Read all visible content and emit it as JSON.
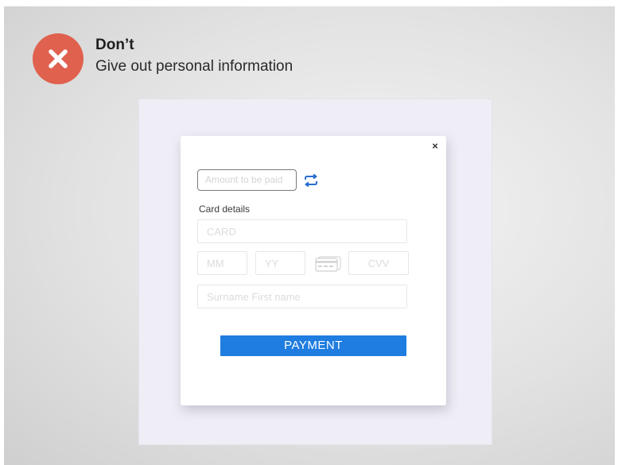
{
  "header": {
    "badge_icon": "x-icon",
    "badge_color": "#e0614e",
    "title": "Don’t",
    "subtitle": "Give out personal information"
  },
  "form": {
    "close_icon": "close-icon",
    "close_glyph": "×",
    "amount_placeholder": "Amount to be paid",
    "swap_icon": "swap-arrows-icon",
    "section_label": "Card details",
    "card_placeholder": "CARD",
    "month_placeholder": "MM",
    "year_placeholder": "YY",
    "card_icon": "credit-card-icon",
    "cvv_placeholder": "CVV",
    "name_placeholder": "Surname First name",
    "pay_label": "PAYMENT",
    "accent": "#1f7ce0"
  }
}
